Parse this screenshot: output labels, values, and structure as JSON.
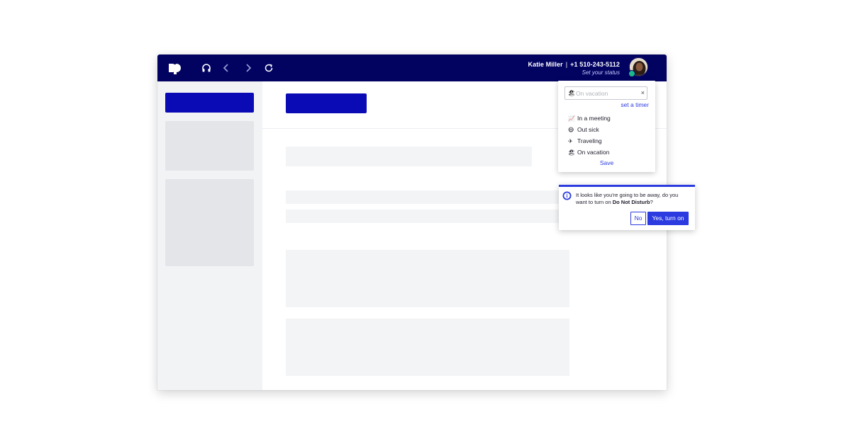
{
  "header": {
    "user_name": "Katie Miller",
    "separator": "|",
    "phone": "+1 510-243-5112",
    "status_prompt": "Set your status",
    "presence": "available"
  },
  "colors": {
    "topbar": "#020361",
    "primary": "#0a0bb4",
    "accent": "#2b3be0",
    "presence": "#1fb88b"
  },
  "icons": {
    "logo": "dialpad-logo-icon",
    "headset": "headset-icon",
    "back": "chevron-left-icon",
    "forward": "chevron-right-icon",
    "refresh": "refresh-icon"
  },
  "status_menu": {
    "input_value": "",
    "input_placeholder": "On vacation",
    "input_emoji": "🏖",
    "clear_label": "×",
    "set_timer": "set a timer",
    "options": [
      {
        "emoji": "📈",
        "label": "In a meeting"
      },
      {
        "emoji": "😷",
        "label": "Out sick"
      },
      {
        "emoji": "✈",
        "label": "Traveling"
      },
      {
        "emoji": "🏖",
        "label": "On vacation"
      }
    ],
    "save_label": "Save"
  },
  "dnd_prompt": {
    "text_before": "It looks like you're going to be away, do you want to turn on ",
    "text_bold": "Do Not Disturb",
    "text_after": "?",
    "no_label": "No",
    "yes_label": "Yes, turn on"
  }
}
